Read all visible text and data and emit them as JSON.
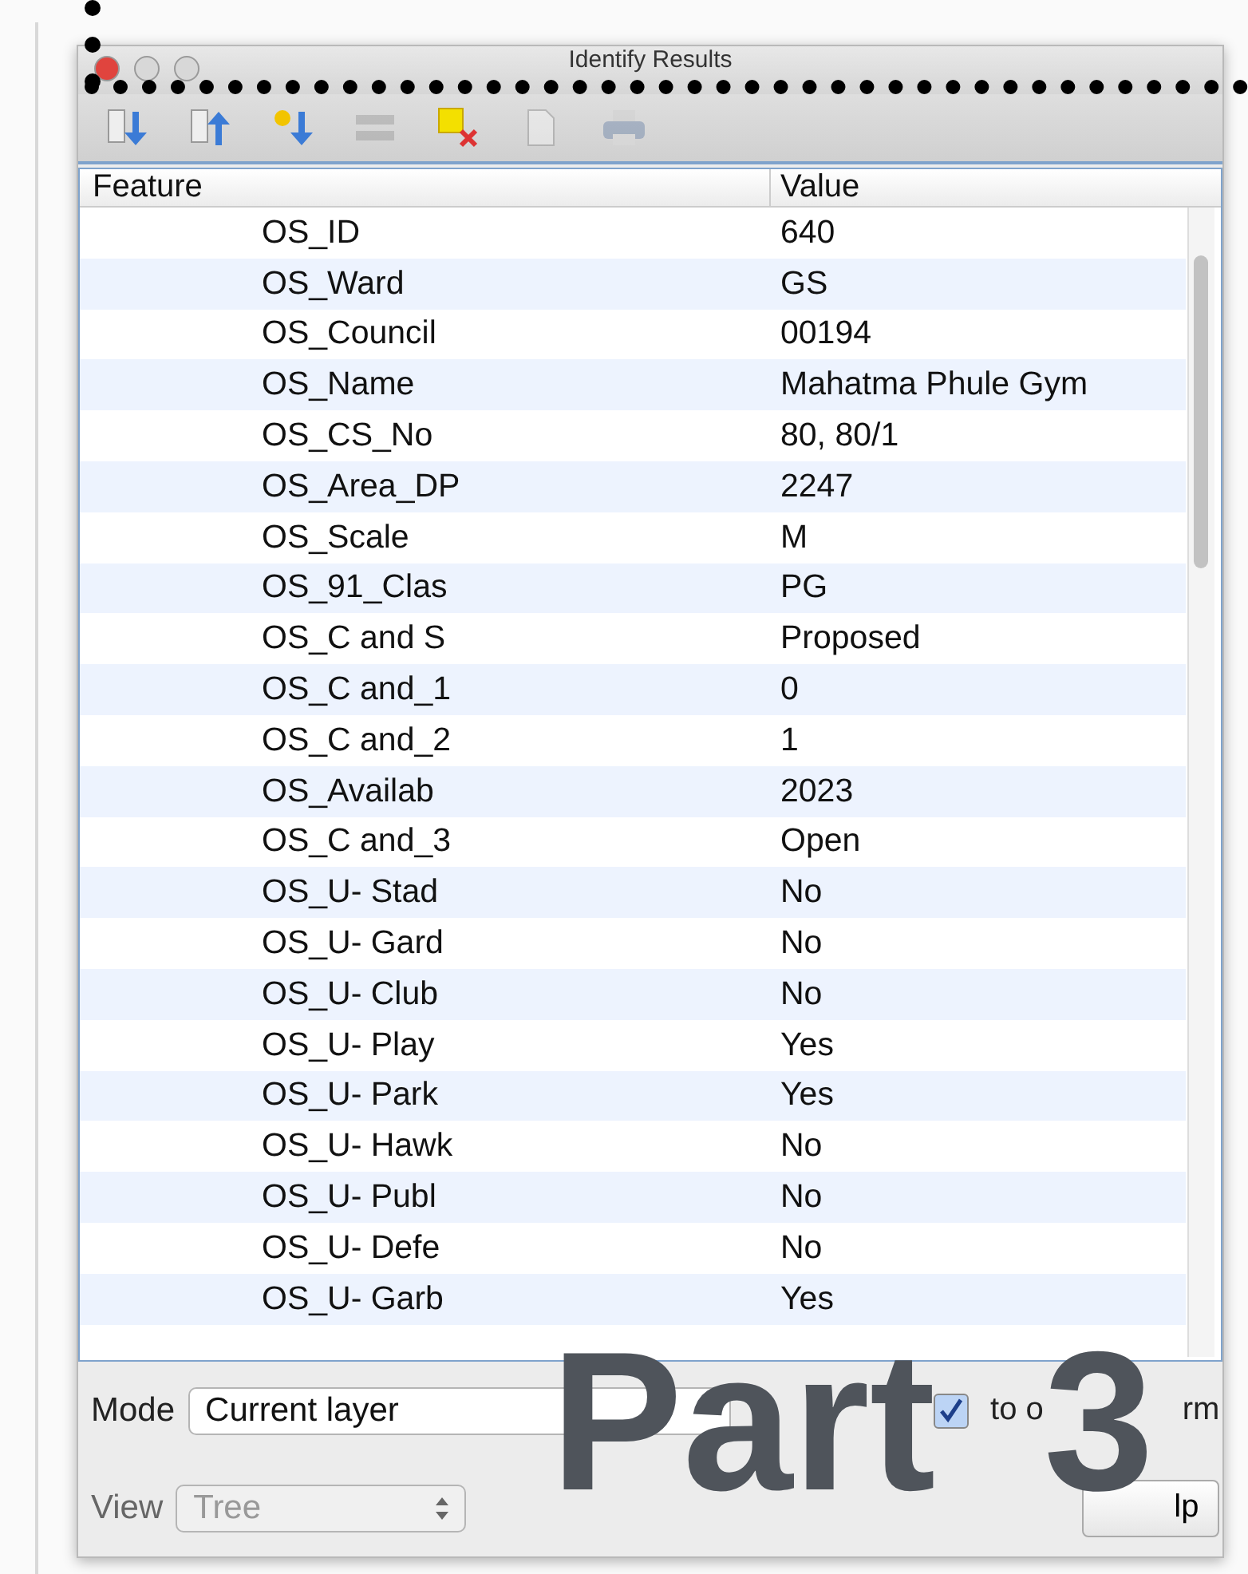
{
  "window": {
    "title": "Identify Results"
  },
  "toolbar": [
    {
      "kind": "expand",
      "disabled": false
    },
    {
      "kind": "collapse",
      "disabled": false
    },
    {
      "kind": "expand_new",
      "disabled": false
    },
    {
      "kind": "list",
      "disabled": true
    },
    {
      "kind": "clear",
      "disabled": false
    },
    {
      "kind": "copy",
      "disabled": true
    },
    {
      "kind": "print",
      "disabled": true
    }
  ],
  "table": {
    "columns": [
      "Feature",
      "Value"
    ],
    "rows": [
      {
        "feature": "OS_ID",
        "value": "640"
      },
      {
        "feature": "OS_Ward",
        "value": "GS"
      },
      {
        "feature": "OS_Council",
        "value": "00194"
      },
      {
        "feature": "OS_Name",
        "value": "Mahatma Phule Gym"
      },
      {
        "feature": "OS_CS_No",
        "value": "80, 80/1"
      },
      {
        "feature": "OS_Area_DP",
        "value": "2247"
      },
      {
        "feature": "OS_Scale",
        "value": "M"
      },
      {
        "feature": "OS_91_Clas",
        "value": "PG"
      },
      {
        "feature": "OS_C and S",
        "value": "Proposed"
      },
      {
        "feature": "OS_C and_1",
        "value": "0"
      },
      {
        "feature": "OS_C and_2",
        "value": "1"
      },
      {
        "feature": "OS_Availab",
        "value": "2023"
      },
      {
        "feature": "OS_C and_3",
        "value": "Open"
      },
      {
        "feature": "OS_U- Stad",
        "value": "No"
      },
      {
        "feature": "OS_U- Gard",
        "value": "No"
      },
      {
        "feature": "OS_U- Club",
        "value": "No"
      },
      {
        "feature": "OS_U- Play",
        "value": "Yes"
      },
      {
        "feature": "OS_U- Park",
        "value": "Yes"
      },
      {
        "feature": "OS_U- Hawk",
        "value": "No"
      },
      {
        "feature": "OS_U- Publ",
        "value": "No"
      },
      {
        "feature": "OS_U- Defe",
        "value": "No"
      },
      {
        "feature": "OS_U- Garb",
        "value": "Yes"
      }
    ]
  },
  "mode": {
    "label": "Mode",
    "value": "Current layer",
    "disabled": false
  },
  "view": {
    "label": "View",
    "value": "Tree",
    "disabled": true
  },
  "auto_open_form": {
    "label_fragments": [
      "to o",
      "rm"
    ],
    "checked": true
  },
  "help_button": "lp",
  "overlay_caption": [
    "Part",
    "3"
  ]
}
